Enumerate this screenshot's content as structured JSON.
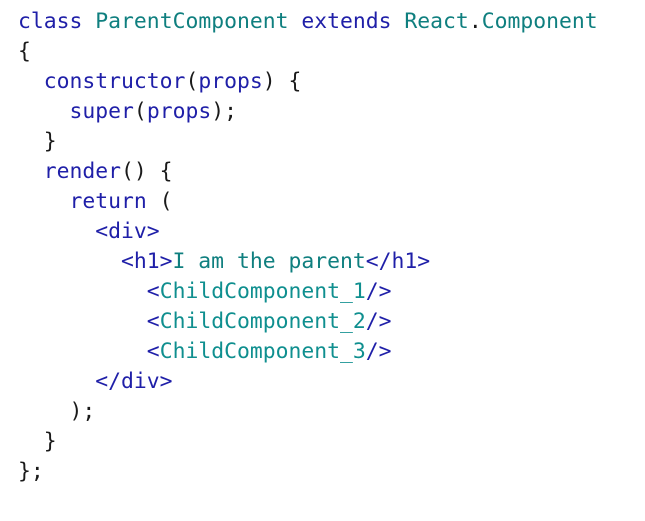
{
  "colors": {
    "keyword": "#1f1fa8",
    "class_name": "#0f7f7f",
    "tag": "#1f1fa8",
    "component": "#0f8f8f",
    "text": "#0f7f7f",
    "punctuation": "#1a1a1a",
    "background": "#ffffff"
  },
  "lines": [
    [
      {
        "t": "class",
        "c": "kw"
      },
      {
        "t": " ",
        "c": "punc"
      },
      {
        "t": "ParentComponent",
        "c": "cls"
      },
      {
        "t": " ",
        "c": "punc"
      },
      {
        "t": "extends",
        "c": "kw"
      },
      {
        "t": " ",
        "c": "punc"
      },
      {
        "t": "React",
        "c": "cls"
      },
      {
        "t": ".",
        "c": "punc"
      },
      {
        "t": "Component",
        "c": "cls"
      }
    ],
    [
      {
        "t": "{",
        "c": "punc"
      }
    ],
    [
      {
        "t": "  ",
        "c": "punc"
      },
      {
        "t": "constructor",
        "c": "kw"
      },
      {
        "t": "(",
        "c": "punc"
      },
      {
        "t": "props",
        "c": "kw"
      },
      {
        "t": ") {",
        "c": "punc"
      }
    ],
    [
      {
        "t": "    ",
        "c": "punc"
      },
      {
        "t": "super",
        "c": "kw"
      },
      {
        "t": "(",
        "c": "punc"
      },
      {
        "t": "props",
        "c": "kw"
      },
      {
        "t": ");",
        "c": "punc"
      }
    ],
    [
      {
        "t": "  }",
        "c": "punc"
      }
    ],
    [
      {
        "t": "  ",
        "c": "punc"
      },
      {
        "t": "render",
        "c": "kw"
      },
      {
        "t": "() {",
        "c": "punc"
      }
    ],
    [
      {
        "t": "    ",
        "c": "punc"
      },
      {
        "t": "return",
        "c": "kw"
      },
      {
        "t": " (",
        "c": "punc"
      }
    ],
    [
      {
        "t": "      ",
        "c": "punc"
      },
      {
        "t": "<div>",
        "c": "tag"
      }
    ],
    [
      {
        "t": "        ",
        "c": "punc"
      },
      {
        "t": "<h1>",
        "c": "tag"
      },
      {
        "t": "I am the parent",
        "c": "text"
      },
      {
        "t": "</h1>",
        "c": "tag"
      }
    ],
    [
      {
        "t": "          ",
        "c": "punc"
      },
      {
        "t": "<",
        "c": "tag"
      },
      {
        "t": "ChildComponent_1",
        "c": "cmp"
      },
      {
        "t": "/>",
        "c": "tag"
      }
    ],
    [
      {
        "t": "          ",
        "c": "punc"
      },
      {
        "t": "<",
        "c": "tag"
      },
      {
        "t": "ChildComponent_2",
        "c": "cmp"
      },
      {
        "t": "/>",
        "c": "tag"
      }
    ],
    [
      {
        "t": "          ",
        "c": "punc"
      },
      {
        "t": "<",
        "c": "tag"
      },
      {
        "t": "ChildComponent_3",
        "c": "cmp"
      },
      {
        "t": "/>",
        "c": "tag"
      }
    ],
    [
      {
        "t": "      ",
        "c": "punc"
      },
      {
        "t": "</div>",
        "c": "tag"
      }
    ],
    [
      {
        "t": "    );",
        "c": "punc"
      }
    ],
    [
      {
        "t": "  }",
        "c": "punc"
      }
    ],
    [
      {
        "t": "};",
        "c": "punc"
      }
    ]
  ]
}
